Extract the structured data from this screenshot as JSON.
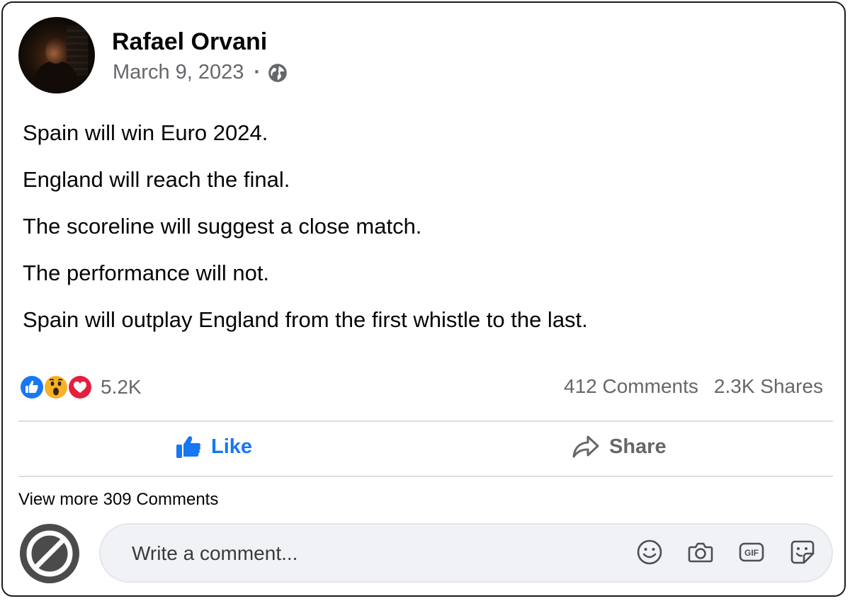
{
  "author": {
    "name": "Rafael Orvani"
  },
  "meta": {
    "date": "March 9, 2023",
    "separator": "·",
    "audience_icon": "globe-icon"
  },
  "post": {
    "lines": [
      "Spain will win Euro 2024.",
      "England will reach the final.",
      "The scoreline will suggest a close match.",
      "The performance will not.",
      "Spain will outplay England from the first whistle to the last."
    ]
  },
  "stats": {
    "reaction_icons": [
      "like-reaction-icon",
      "wow-reaction-icon",
      "love-reaction-icon"
    ],
    "reaction_count": "5.2K",
    "comments": "412 Comments",
    "shares": "2.3K Shares"
  },
  "actions": {
    "like_label": "Like",
    "share_label": "Share"
  },
  "comments_section": {
    "view_more": "View more 309 Comments",
    "input_placeholder": "Write a comment...",
    "tool_icons": [
      "emoji-icon",
      "camera-icon",
      "gif-icon",
      "sticker-icon"
    ]
  },
  "colors": {
    "accent": "#1877f2",
    "secondary_text": "#65676b",
    "love": "#e41e3f",
    "wow": "#f7b125"
  }
}
